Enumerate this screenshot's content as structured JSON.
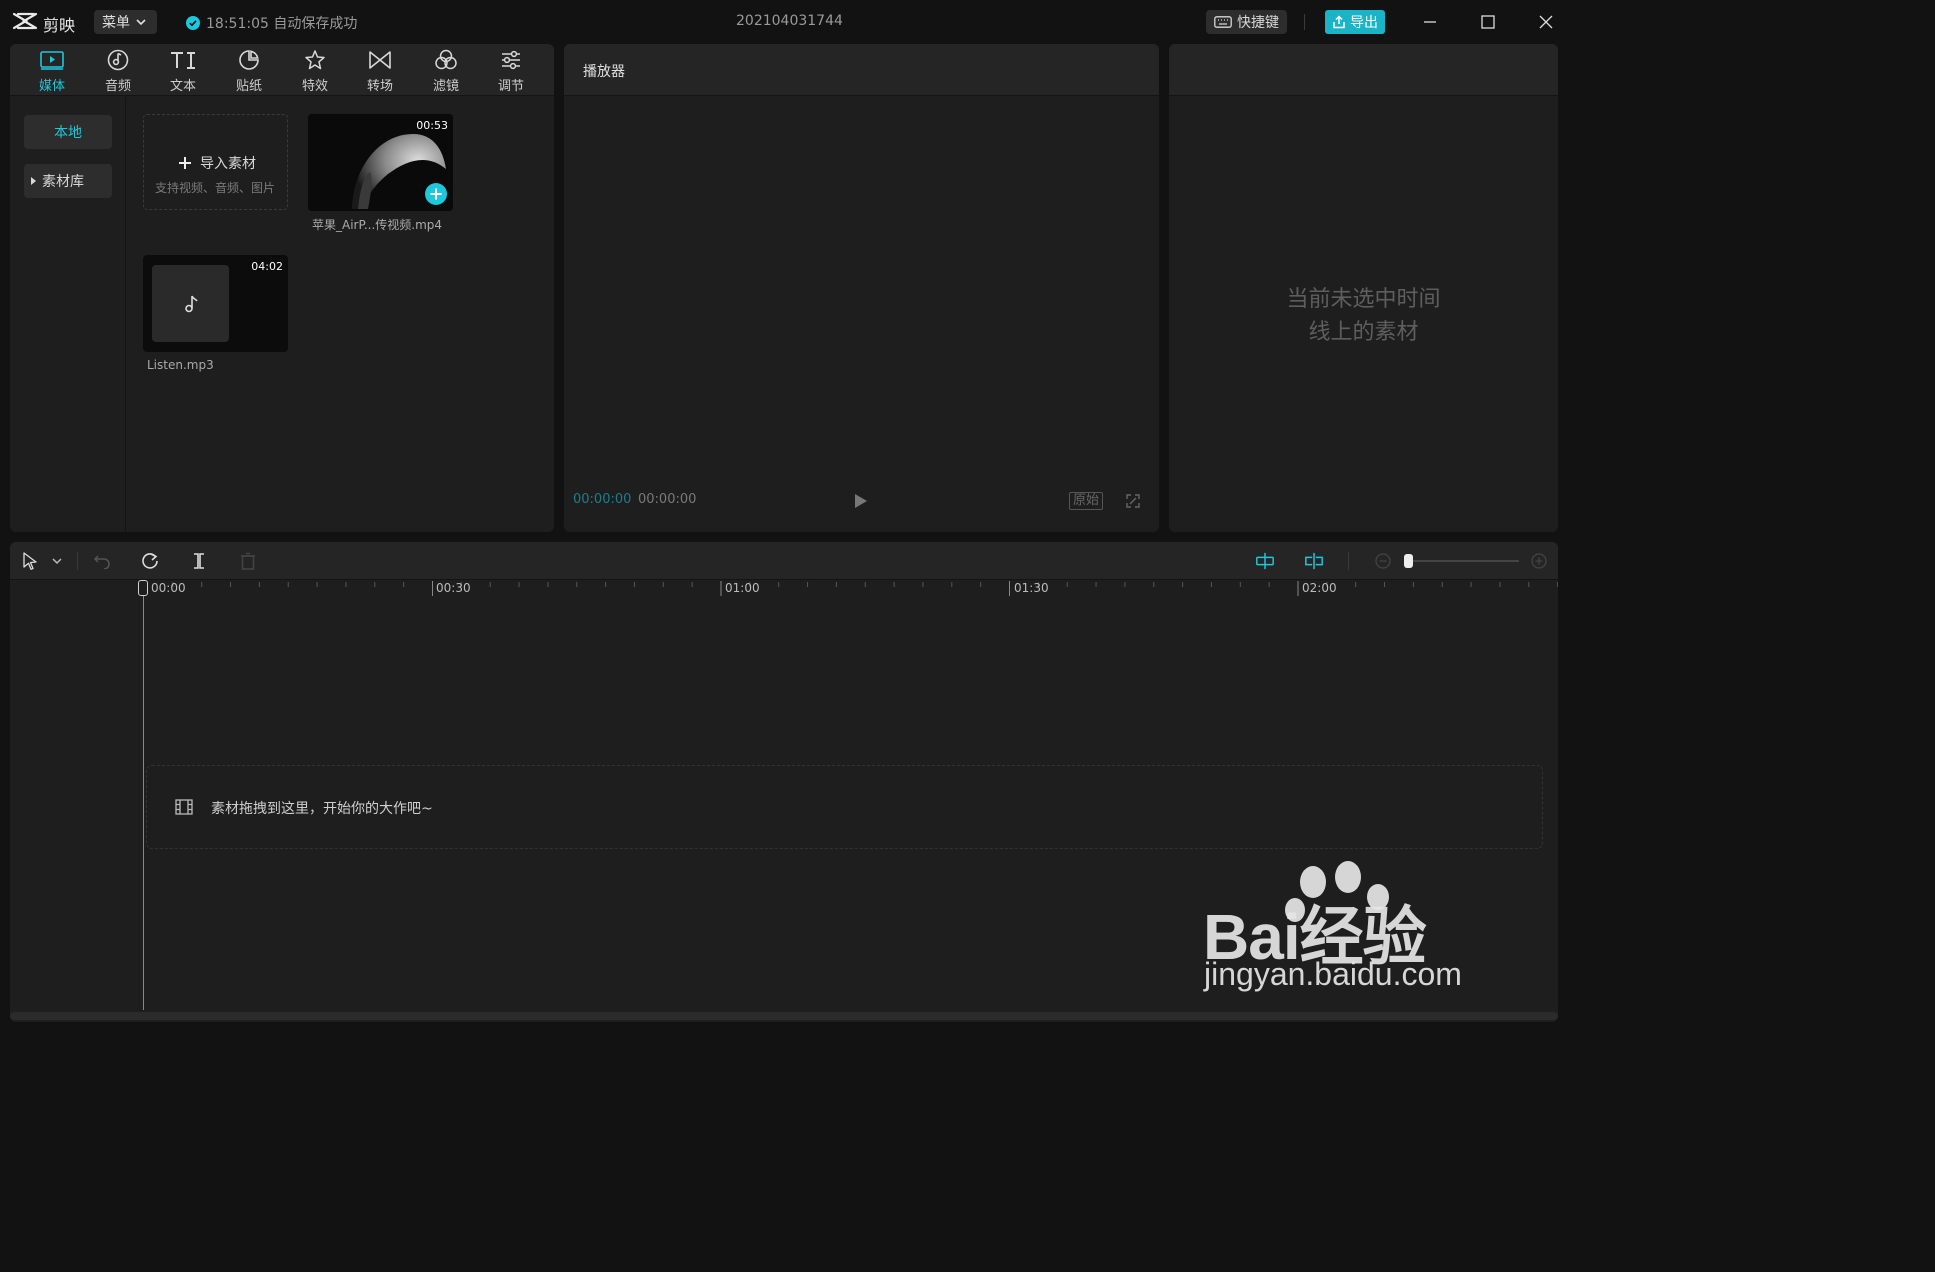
{
  "app": {
    "name": "剪映",
    "menu_label": "菜单",
    "save_status": "18:51:05 自动保存成功",
    "project_name": "202104031744",
    "hotkey_label": "快捷键",
    "export_label": "导出"
  },
  "tool_tabs": [
    {
      "label": "媒体",
      "icon": "media-icon",
      "active": true
    },
    {
      "label": "音频",
      "icon": "audio-icon",
      "active": false
    },
    {
      "label": "文本",
      "icon": "text-icon",
      "active": false
    },
    {
      "label": "贴纸",
      "icon": "sticker-icon",
      "active": false
    },
    {
      "label": "特效",
      "icon": "effect-icon",
      "active": false
    },
    {
      "label": "转场",
      "icon": "transition-icon",
      "active": false
    },
    {
      "label": "滤镜",
      "icon": "filter-icon",
      "active": false
    },
    {
      "label": "调节",
      "icon": "adjust-icon",
      "active": false
    }
  ],
  "media_sidebar": {
    "local": "本地",
    "library": "素材库"
  },
  "import_card": {
    "title": "导入素材",
    "subtitle": "支持视频、音频、图片"
  },
  "media_items": [
    {
      "name": "苹果_AirP...传视频.mp4",
      "duration": "00:53",
      "type": "video"
    },
    {
      "name": "Listen.mp3",
      "duration": "04:02",
      "type": "audio"
    }
  ],
  "player": {
    "title": "播放器",
    "current_time": "00:00:00",
    "total_time": "00:00:00",
    "ratio_label": "原始"
  },
  "properties": {
    "empty_line1": "当前未选中时间",
    "empty_line2": "线上的素材"
  },
  "timeline": {
    "ticks": [
      "00:00",
      "00:30",
      "01:00",
      "01:30",
      "02:00"
    ],
    "drop_hint": "素材拖拽到这里，开始你的大作吧~"
  },
  "watermark": {
    "brand": "Bai经验",
    "url": "jingyan.baidu.com"
  },
  "colors": {
    "accent": "#1ec8dc",
    "export_bg": "#1bb4c6",
    "panel_bg": "#1e1e1e",
    "app_bg": "#121212"
  }
}
